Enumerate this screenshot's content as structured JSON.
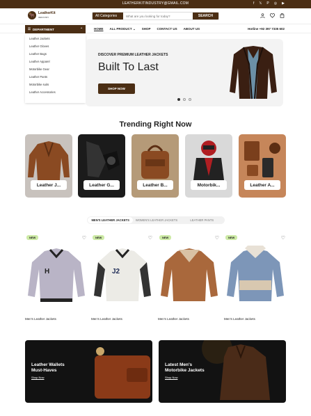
{
  "topbar": {
    "email": "LEATHERKITINDUSTRY@GMAIL.COM",
    "social": [
      "f",
      "𝕏",
      "P",
      "◎",
      "▶"
    ]
  },
  "header": {
    "logo_text": "LeatherKit",
    "logo_sub": "INDUSTRY",
    "search_category": "All Categories",
    "search_placeholder": "What are you looking for today?",
    "search_button": "SEARCH"
  },
  "nav": {
    "department_label": "DEPARTMENT",
    "menu": [
      "HOME",
      "ALL PRODUCT",
      "SHOP",
      "CONTACT US",
      "ABOUT US"
    ],
    "hotline": "Hotline +92 397 7335 602"
  },
  "departments": [
    "Leather Jackets",
    "Leather Gloves",
    "Leather Bags",
    "Leather Apparel",
    "Motorbike Gear",
    "Leather Pants",
    "Motorbike suits",
    "Leather Accessories"
  ],
  "hero": {
    "kicker": "DISCOVER PREMIUM LEATHER JACKETS",
    "title": "Built To Last",
    "button": "SHOP NOW"
  },
  "trending": {
    "title": "Trending Right Now",
    "categories": [
      "Leather J...",
      "Leather G...",
      "Leather B...",
      "Motorbik...",
      "Leather A..."
    ]
  },
  "tabs": [
    "MEN'S LEATHER JACKETS",
    "WOMEN'S LEATHER JACKETS",
    "LEATHER PANTS"
  ],
  "products": [
    {
      "badge": "NEW",
      "name": "Men's Leather Jackets"
    },
    {
      "badge": "NEW",
      "name": "Men's Leather Jackets"
    },
    {
      "badge": "NEW",
      "name": "Men's Leather Jackets"
    },
    {
      "badge": "NEW",
      "name": "Men's Leather Jackets"
    }
  ],
  "banners": [
    {
      "title": "Leather Wallets Must-Haves",
      "link": "Shop Now"
    },
    {
      "title": "Latest Men's Motorbike Jackets",
      "link": "Shop Now"
    }
  ]
}
